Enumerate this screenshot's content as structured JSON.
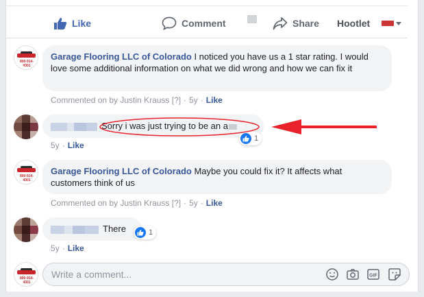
{
  "actions": {
    "like": "Like",
    "comment": "Comment",
    "share": "Share",
    "hootlet": "Hootlet"
  },
  "comments": [
    {
      "author": "Garage Flooring LLC of Colorado",
      "text": " I noticed you have us a 1 star rating. I would love some additional information on what we did wrong and how we can fix it",
      "meta_by": "Commented on by Justin Krauss [?]",
      "time": "5y",
      "like": "Like",
      "logo_text": "800-914-4301"
    },
    {
      "author": "",
      "text": "Sorry i was just trying to be an a",
      "time": "5y",
      "like": "Like",
      "reactions": "1"
    },
    {
      "author": "Garage Flooring LLC of Colorado",
      "text": " Maybe you could fix it? It affects what customers think of us",
      "meta_by": "Commented on by Justin Krauss [?]",
      "time": "5y",
      "like": "Like",
      "logo_text": "800-914-4301"
    },
    {
      "author": "",
      "text": "There",
      "time": "5y",
      "like": "Like",
      "reactions": "1"
    }
  ],
  "composer": {
    "placeholder": "Write a comment...",
    "logo_text": "800-914-4301"
  },
  "colors": {
    "link": "#385898",
    "like_blue": "#4267b2",
    "annotation_red": "#e8212a"
  },
  "icons": [
    "thumbs-up-icon",
    "comment-icon",
    "share-icon",
    "emoji-icon",
    "camera-icon",
    "gif-icon",
    "sticker-icon"
  ]
}
